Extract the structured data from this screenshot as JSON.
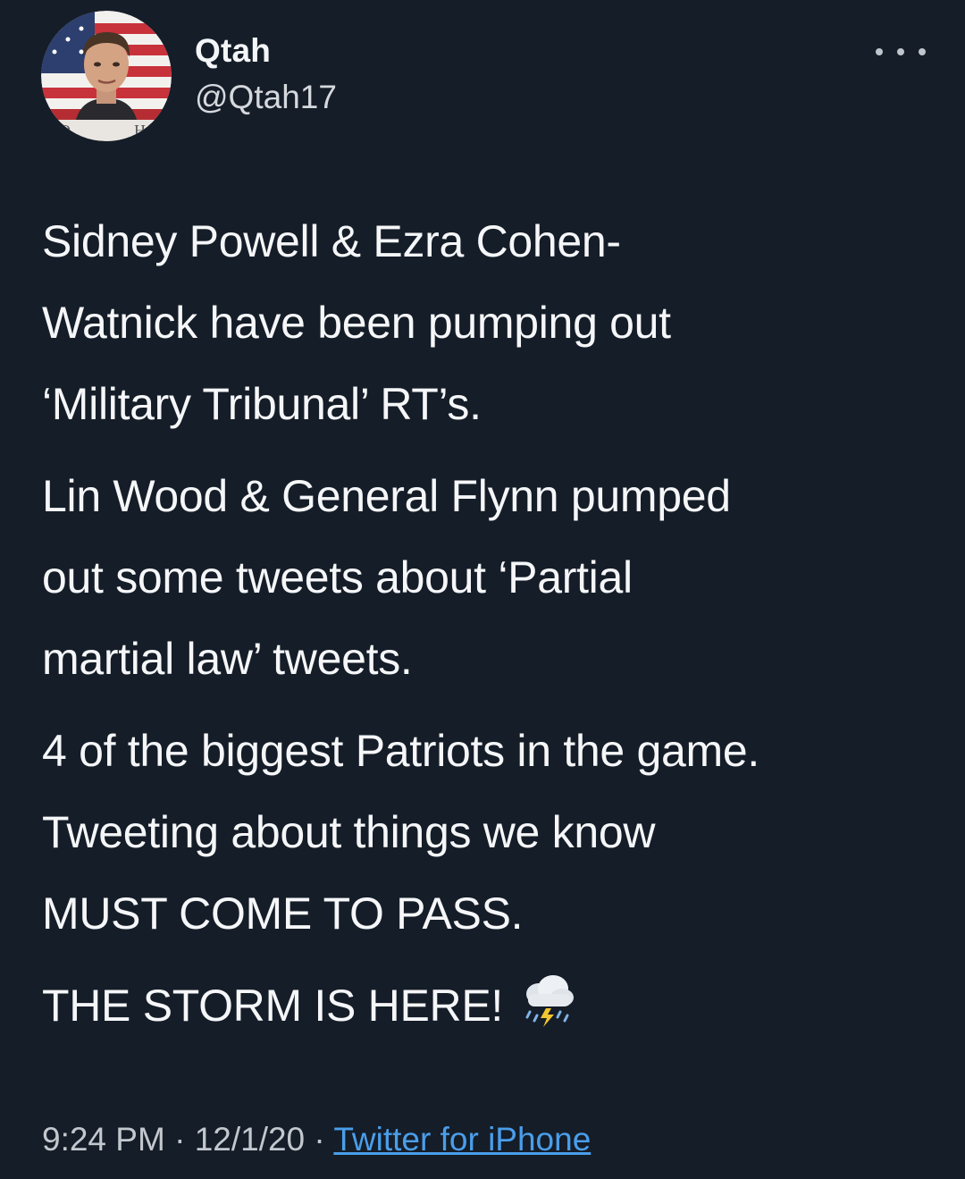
{
  "author": {
    "display_name": "Qtah",
    "handle": "@Qtah17",
    "avatar_icon": "profile-photo-flag-background"
  },
  "more_icon": "more-horizontal-icon",
  "tweet": {
    "paragraphs": [
      {
        "lines": [
          "Sidney Powell & Ezra Cohen-",
          "Watnick have been pumping out",
          "‘Military Tribunal’ RT’s."
        ]
      },
      {
        "lines": [
          "Lin Wood & General Flynn pumped",
          "out some tweets about ‘Partial",
          "martial law’ tweets."
        ]
      },
      {
        "lines": [
          "4 of the biggest Patriots in the game.",
          "Tweeting about things we know",
          "MUST COME TO PASS."
        ]
      },
      {
        "lines": [
          "THE STORM IS HERE!"
        ],
        "emoji": "cloud-with-lightning-and-rain"
      }
    ]
  },
  "meta": {
    "time": "9:24 PM",
    "separator": "·",
    "date": "12/1/20",
    "source": "Twitter for iPhone"
  },
  "colors": {
    "background": "#151d28",
    "text": "#f5f6f8",
    "link": "#4a9eea"
  }
}
